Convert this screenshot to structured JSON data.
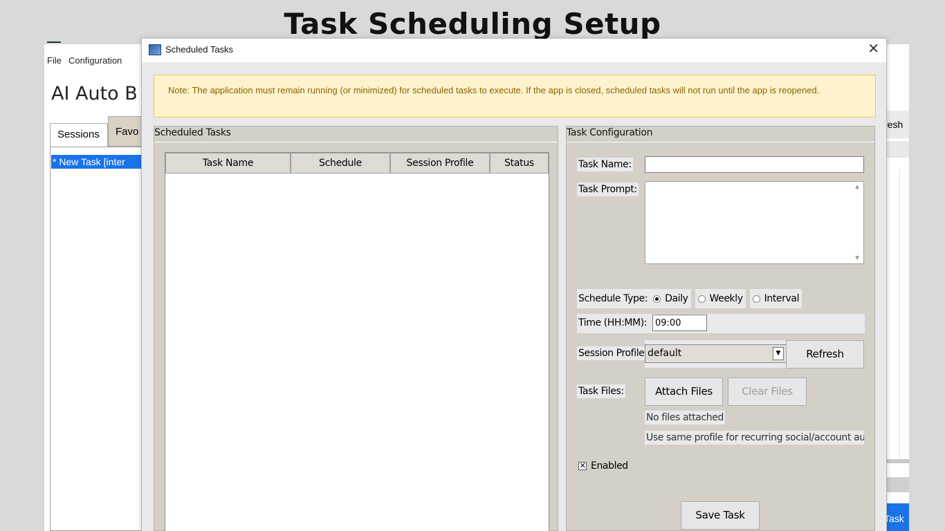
{
  "page_heading": "Task Scheduling Setup",
  "background_app": {
    "menu": [
      "File",
      "Configuration"
    ],
    "title": "AI Auto B",
    "tabs": {
      "sessions": "Sessions",
      "favorites": "Favo"
    },
    "list_item": "* New Task [inter",
    "right_tab_label": "resh",
    "right_button_label": "Task"
  },
  "dialog": {
    "title": "Scheduled Tasks",
    "close_glyph": "✕",
    "note": "Note: The application must remain running (or minimized) for scheduled tasks to execute. If the app is closed, scheduled tasks will not run until the app is reopened.",
    "left_pane": {
      "label": "Scheduled Tasks",
      "columns": [
        "Task Name",
        "Schedule",
        "Session Profile",
        "Status"
      ],
      "rows": []
    },
    "right_pane": {
      "label": "Task Configuration",
      "task_name_label": "Task Name:",
      "task_name_value": "",
      "task_prompt_label": "Task Prompt:",
      "task_prompt_value": "",
      "schedule_type_label": "Schedule Type:",
      "schedule_options": [
        "Daily",
        "Weekly",
        "Interval"
      ],
      "schedule_selected": "Daily",
      "time_label": "Time (HH:MM):",
      "time_value": "09:00",
      "session_profile_label": "Session Profile:",
      "session_profile_value": "default",
      "refresh_label": "Refresh",
      "task_files_label": "Task Files:",
      "attach_files_label": "Attach Files",
      "clear_files_label": "Clear Files",
      "no_files_text": "No files attached",
      "profile_hint": "Use same profile for recurring social/account auto",
      "enabled_label": "Enabled",
      "enabled_checked": true,
      "save_label": "Save Task"
    }
  },
  "colors": {
    "note_bg": "#fff3cd",
    "note_border": "#e8c84a",
    "note_text": "#8a6200",
    "accent_blue": "#1a73e8"
  }
}
